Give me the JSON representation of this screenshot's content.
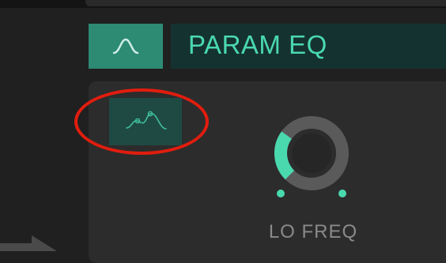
{
  "header": {
    "module_icon": "bell-curve-icon",
    "title": "PARAM EQ"
  },
  "eq_mode_button": {
    "icon": "multiband-eq-curve-icon",
    "highlighted": true
  },
  "knob": {
    "label": "LO FREQ",
    "value_fraction": 0.3
  },
  "colors": {
    "accent": "#4ad9ae",
    "accent_button": "#2d8a73",
    "title_bg": "#143230",
    "panel_bg": "#2c2c2c",
    "annotation": "#e11d0e"
  }
}
